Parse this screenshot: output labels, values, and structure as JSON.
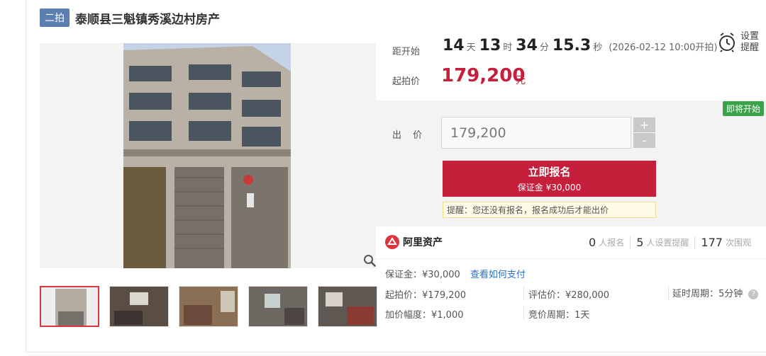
{
  "title": {
    "round_badge": "二拍",
    "text": "泰顺县三魁镇秀溪边村房产"
  },
  "countdown": {
    "label": "距开始",
    "days": "14",
    "days_unit": "天",
    "hours": "13",
    "hours_unit": "时",
    "minutes": "34",
    "minutes_unit": "分",
    "seconds": "15.3",
    "seconds_unit": "秒",
    "start_note": "(2026-02-12 10:00开拍)"
  },
  "remind": {
    "label": "设置提醒",
    "icon": "alarm-clock-icon"
  },
  "start_price": {
    "label": "起拍价",
    "value": "179,200",
    "unit": "元"
  },
  "bid": {
    "status_badge": "即将开始",
    "label": "出 价",
    "input_value": "179,200",
    "plus": "+",
    "minus": "-",
    "signup_label": "立即报名",
    "signup_deposit": "保证金 ¥30,000",
    "tip": "提醒：您还没有报名，报名成功后才能出价"
  },
  "platform": {
    "name": "阿里资产",
    "icon": "ali-asset-logo-icon"
  },
  "stats": [
    {
      "num": "0",
      "label": "人报名"
    },
    {
      "num": "5",
      "label": "人设置提醒"
    },
    {
      "num": "177",
      "label": "次围观"
    }
  ],
  "details": {
    "deposit": "保证金：¥30,000",
    "pay_link": "查看如何支付",
    "start_price": "起拍价：¥179,200",
    "appraisal": "评估价：¥280,000",
    "delay_period": "延时周期：5分钟",
    "increment": "加价幅度：¥1,000",
    "bid_period": "竞价周期：1天"
  },
  "colors": {
    "accent": "#c61f3c",
    "badge_blue": "#5b7fb0",
    "badge_green": "#3aa34a",
    "link": "#2d6fc4"
  }
}
